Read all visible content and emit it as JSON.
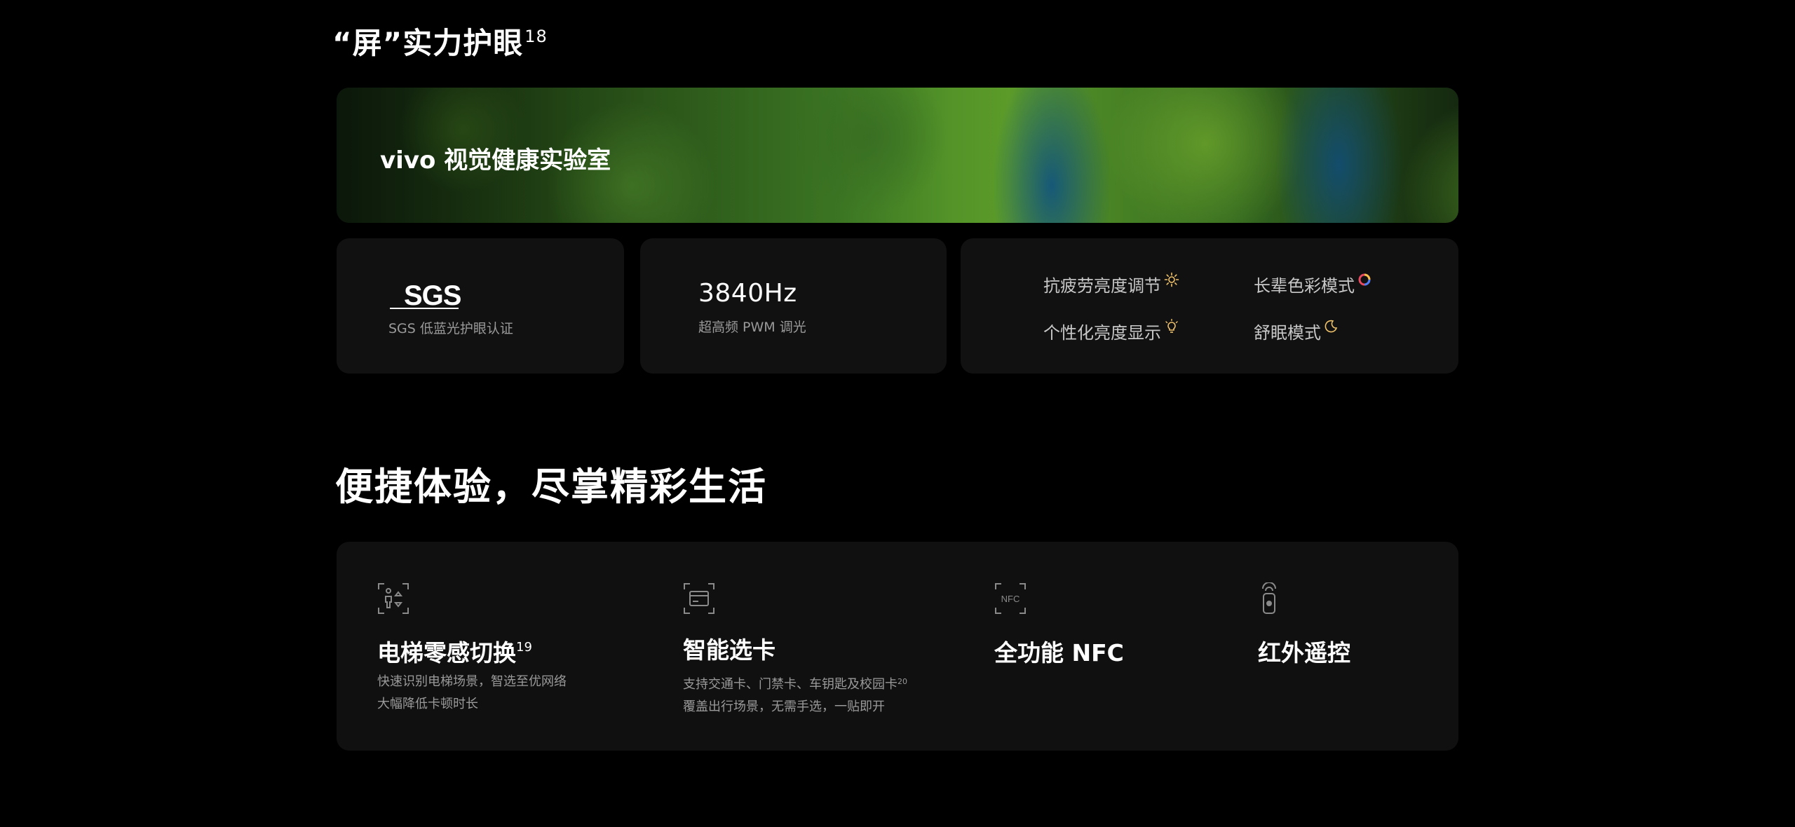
{
  "eye_care": {
    "title": "“屏”实力护眼",
    "title_note": "18",
    "banner": {
      "title": "vivo 视觉健康实验室"
    },
    "sgs": {
      "logo": "SGS",
      "caption": "SGS 低蓝光护眼认证"
    },
    "pwm": {
      "value": "3840Hz",
      "caption": "超高频 PWM 调光"
    },
    "modes": [
      {
        "label": "抗疲劳亮度调节",
        "icon": "sun-icon"
      },
      {
        "label": "长辈色彩模式",
        "icon": "color-ring-icon"
      },
      {
        "label": "个性化亮度显示",
        "icon": "bulb-icon"
      },
      {
        "label": "舒眠模式",
        "icon": "moon-icon"
      }
    ]
  },
  "convenience": {
    "headline": "便捷体验，尽掌精彩生活",
    "features": [
      {
        "icon": "elevator-person-icon",
        "title": "电梯零感切换",
        "note": "19",
        "desc": [
          "快速识别电梯场景，智选至优网络",
          "大幅降低卡顿时长"
        ]
      },
      {
        "icon": "card-icon",
        "title": "智能选卡",
        "note": "",
        "desc": [
          "支持交通卡、门禁卡、车钥匙及校园卡",
          "覆盖出行场景，无需手选，一贴即开"
        ],
        "desc_note": "20"
      },
      {
        "icon": "nfc-icon",
        "icon_text": "NFC",
        "title": "全功能 NFC",
        "desc": []
      },
      {
        "icon": "remote-control-icon",
        "title": "红外遥控",
        "desc": []
      }
    ]
  },
  "colors": {
    "background": "#000000",
    "card": "#111111",
    "muted_text": "#9a9a9a"
  }
}
